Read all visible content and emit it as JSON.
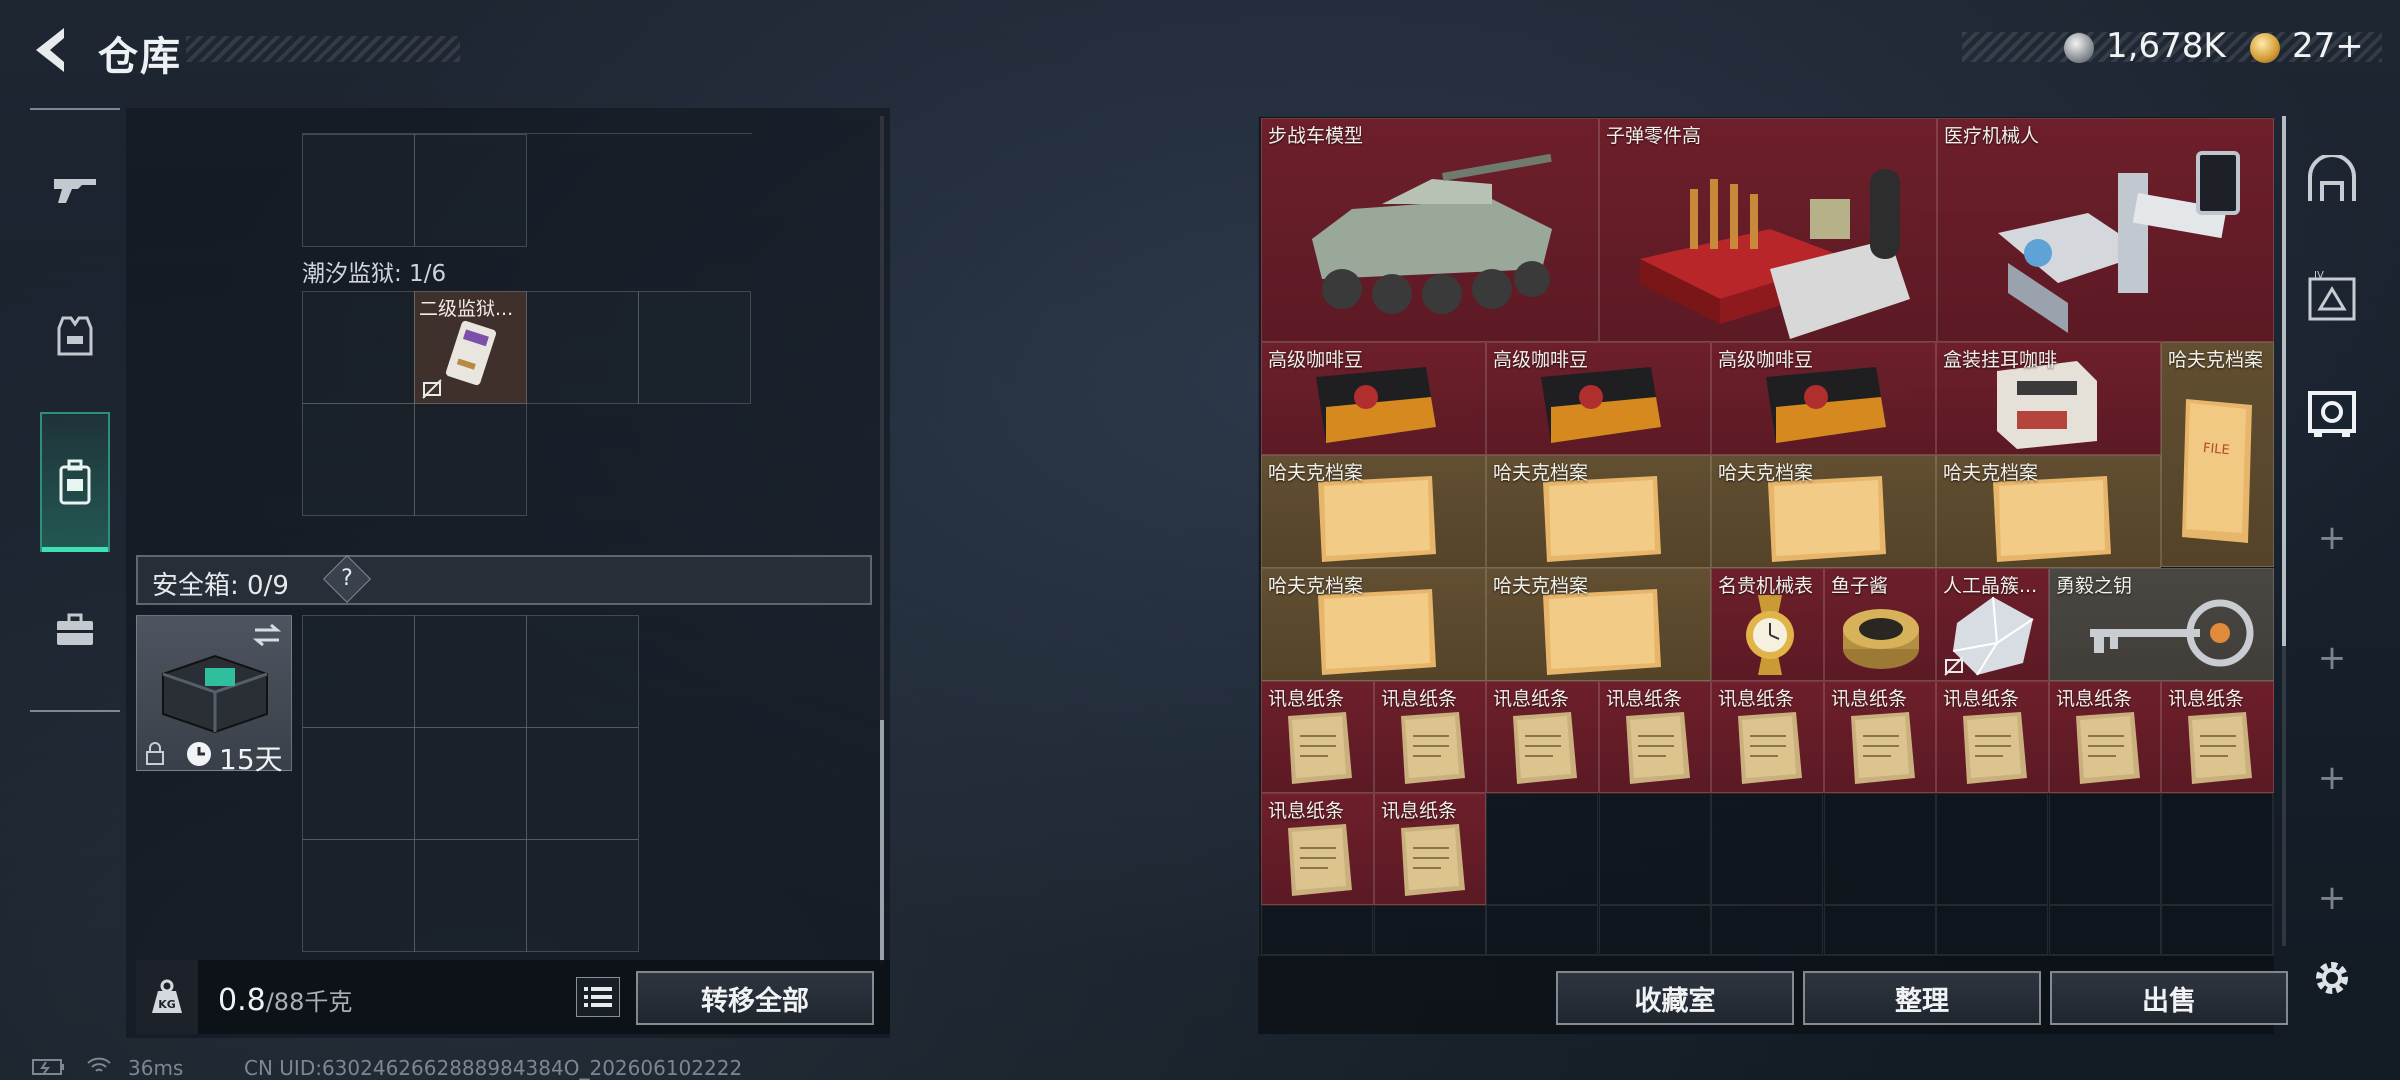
{
  "header": {
    "title": "仓库"
  },
  "currency": {
    "silver": "1,678K",
    "gold": "27+"
  },
  "left_panel": {
    "grid_label": "潮汐监狱: 1/6",
    "grid_item_label": "二级监狱...",
    "safebox_label": "安全箱: 0/9",
    "help_symbol": "?",
    "safebox_timer": "15天",
    "weight_value": "0.8",
    "weight_max": "/88千克",
    "transfer_all": "转移全部"
  },
  "nav": [
    {
      "name": "weapons-tab",
      "icon": "gun-icon"
    },
    {
      "name": "armor-tab",
      "icon": "vest-icon"
    },
    {
      "name": "backpack-tab",
      "icon": "backpack-icon",
      "active": true
    },
    {
      "name": "toolbox-tab",
      "icon": "briefcase-icon"
    }
  ],
  "stash": {
    "items": [
      {
        "label": "步战车模型",
        "color": "red"
      },
      {
        "label": "子弹零件高",
        "color": "red"
      },
      {
        "label": "医疗机械人",
        "color": "red"
      },
      {
        "label": "高级咖啡豆",
        "color": "red"
      },
      {
        "label": "高级咖啡豆",
        "color": "red"
      },
      {
        "label": "高级咖啡豆",
        "color": "red"
      },
      {
        "label": "盒装挂耳咖啡",
        "color": "red"
      },
      {
        "label": "哈夫克档案",
        "color": "gold"
      },
      {
        "label": "哈夫克档案",
        "color": "gold"
      },
      {
        "label": "哈夫克档案",
        "color": "gold"
      },
      {
        "label": "哈夫克档案",
        "color": "gold"
      },
      {
        "label": "哈夫克档案",
        "color": "gold"
      },
      {
        "label": "哈夫克档案",
        "color": "gold"
      },
      {
        "label": "哈夫克档案",
        "color": "gold"
      },
      {
        "label": "名贵机械表",
        "color": "red"
      },
      {
        "label": "鱼子酱",
        "color": "red"
      },
      {
        "label": "人工晶簇...",
        "color": "red"
      },
      {
        "label": "勇毅之钥",
        "color": "gold"
      },
      {
        "label": "讯息纸条",
        "color": "red"
      }
    ],
    "note_label": "讯息纸条",
    "buttons": {
      "collection": "收藏室",
      "sort": "整理",
      "sell": "出售"
    }
  },
  "status": {
    "ping": "36ms",
    "uid": "CN UID:6302462662888984384O_202606102222"
  },
  "colors": {
    "accent": "#3fe0b6",
    "red_item": "#7a202c",
    "gold_item": "#705834"
  }
}
